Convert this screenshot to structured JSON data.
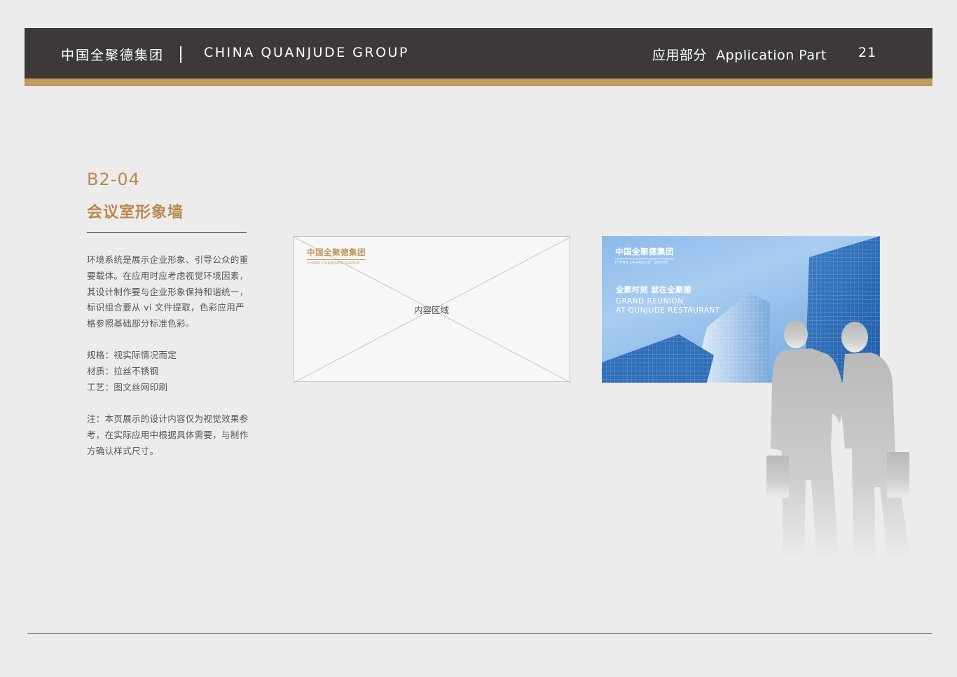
{
  "header": {
    "company_cn": "中国全聚德集团",
    "company_en": "CHINA QUANJUDE GROUP",
    "section": "应用部分  Application Part",
    "page_number": "21"
  },
  "section": {
    "code": "B2-04",
    "title": "会议室形象墙",
    "description": "环境系统是展示企业形象、引导公众的重要载体。在应用时应考虑视觉环境因素，其设计制作要与企业形象保持和谐统一，标识组合要从 vi 文件提取，色彩应用严格参照基础部分标准色彩。",
    "specs": [
      "规格：视实际情况而定",
      "材质：拉丝不锈钢",
      "工艺：图文丝网印刷"
    ],
    "note": "注：本页展示的设计内容仅为视觉效果参考，在实际应用中根据具体需要，与制作方确认样式尺寸。"
  },
  "mockup_left": {
    "logo_cn": "中国全聚德集团",
    "logo_en": "CHINA QUANJUDE GROUP",
    "content_label": "内容区域"
  },
  "mockup_right": {
    "logo_cn": "中国全聚德集团",
    "logo_en": "CHINA QUANJUDE GROUP",
    "slogan_cn": "全聚时刻 就在全聚德",
    "slogan_en_1": "GRAND REUNION",
    "slogan_en_2": "AT QUNJUDE RESTAURANT"
  },
  "colors": {
    "header_bg": "#3d3939",
    "accent_gold": "#c09a5e",
    "page_bg": "#ececec"
  }
}
